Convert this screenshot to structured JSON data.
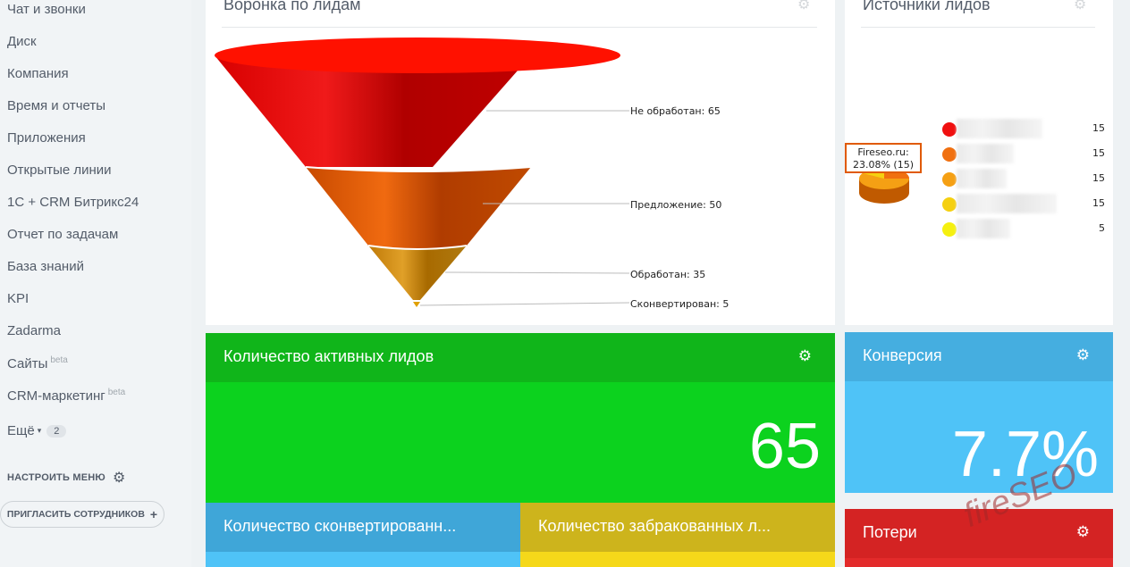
{
  "sidebar": {
    "items": [
      {
        "label": "Чат и звонки"
      },
      {
        "label": "Диск"
      },
      {
        "label": "Компания"
      },
      {
        "label": "Время и отчеты"
      },
      {
        "label": "Приложения"
      },
      {
        "label": "Открытые линии"
      },
      {
        "label": "1С + CRM Битрикс24"
      },
      {
        "label": "Отчет по задачам"
      },
      {
        "label": "База знаний"
      },
      {
        "label": "KPI"
      },
      {
        "label": "Zadarma"
      },
      {
        "label": "Сайты",
        "badge": "beta"
      },
      {
        "label": "CRM-маркетинг",
        "badge": "beta"
      }
    ],
    "more_label": "Ещё",
    "more_count": "2",
    "configure_menu": "НАСТРОИТЬ МЕНЮ",
    "invite_button": "ПРИГЛАСИТЬ СОТРУДНИКОВ"
  },
  "funnel_panel": {
    "title": "Воронка по лидам",
    "stages": [
      {
        "label": "Не обработан: 65",
        "value": 65,
        "color": "#e00000"
      },
      {
        "label": "Предложение: 50",
        "value": 50,
        "color": "#e05a00"
      },
      {
        "label": "Обработан: 35",
        "value": 35,
        "color": "#d48a10"
      },
      {
        "label": "Сконвертирован: 5",
        "value": 5,
        "color": "#e0a000"
      }
    ]
  },
  "sources_panel": {
    "title": "Источники лидов",
    "tooltip_line1": "Fireseo.ru:",
    "tooltip_line2": "23.08% (15)",
    "legend": [
      {
        "color": "#f01010",
        "value": "15"
      },
      {
        "color": "#f07010",
        "value": "15"
      },
      {
        "color": "#f5a014",
        "value": "15"
      },
      {
        "color": "#f5d010",
        "value": "15"
      },
      {
        "color": "#f5f010",
        "value": "5"
      }
    ]
  },
  "tiles": {
    "active_leads": {
      "title": "Количество активных лидов",
      "value": "65",
      "color": "#0cd21e",
      "head_color": "#10b51a"
    },
    "conversion": {
      "title": "Конверсия",
      "value": "7.7%",
      "color": "#4fc3f7",
      "head_color": "#45aee0"
    },
    "converted": {
      "title": "Количество сконвертированн...",
      "color": "#4fc3f7",
      "head_color": "#3fa6d8"
    },
    "rejected": {
      "title": "Количество забракованных л...",
      "color": "#f5d81a",
      "head_color": "#cdb41c"
    },
    "losses": {
      "title": "Потери",
      "color": "#e32b2b",
      "head_color": "#d42323"
    }
  },
  "watermark": "fireSEO"
}
